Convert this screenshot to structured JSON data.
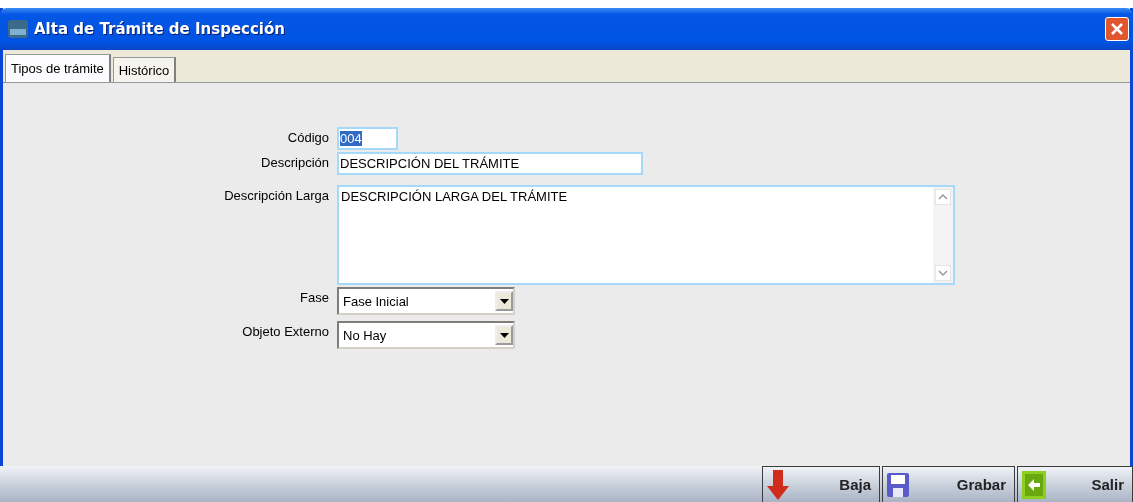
{
  "window": {
    "title": "Alta de Trámite de Inspección"
  },
  "tabs": [
    {
      "label": "Tipos de trámite",
      "selected": true
    },
    {
      "label": "Histórico",
      "selected": false
    }
  ],
  "form": {
    "codigo": {
      "label": "Código",
      "value": "004",
      "text_selected": true
    },
    "descripcion": {
      "label": "Descripción",
      "value": "DESCRIPCIÓN DEL TRÁMITE"
    },
    "descripcion_larga": {
      "label": "Descripción Larga",
      "value": "DESCRIPCIÓN LARGA DEL TRÁMITE"
    },
    "fase": {
      "label": "Fase",
      "value": "Fase Inicial"
    },
    "objeto_externo": {
      "label": "Objeto Externo",
      "value": "No Hay"
    }
  },
  "buttons": [
    {
      "kind": "delete",
      "label": "Baja"
    },
    {
      "kind": "save",
      "label": "Grabar"
    },
    {
      "kind": "exit",
      "label": "Salir"
    }
  ]
}
